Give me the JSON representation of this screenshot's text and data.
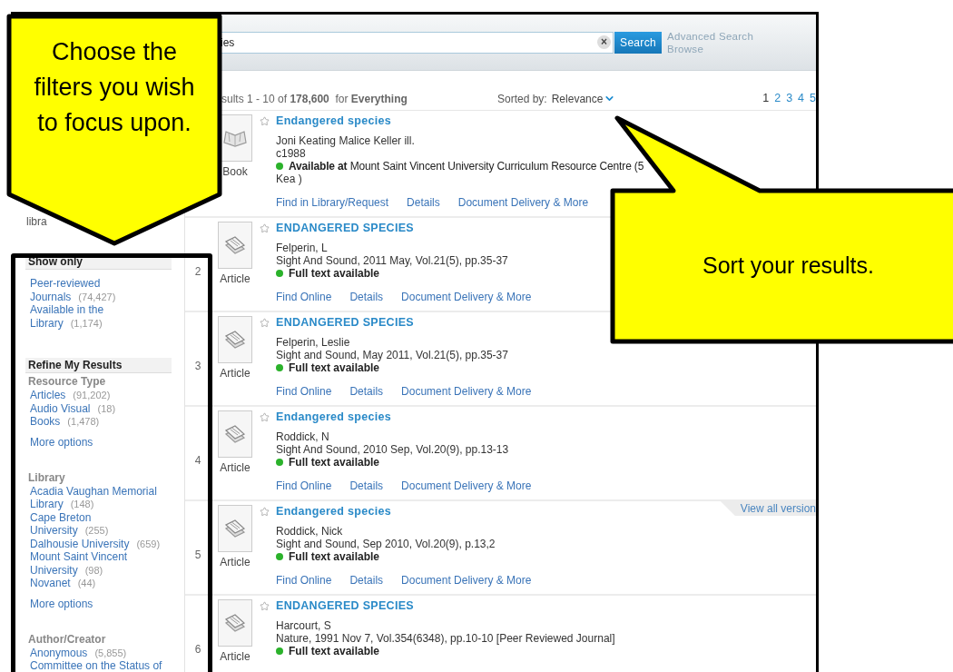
{
  "search": {
    "value": "ies",
    "clear": "×",
    "button": "Search",
    "links": [
      "Advanced Search",
      "Browse"
    ]
  },
  "results_bar": {
    "summary": "sults 1 - 10 of **178,600**  for **Everything**",
    "sort_label": "Sorted by:",
    "sort_value": "Relevance",
    "pages": [
      {
        "label": "1",
        "selected": true
      },
      {
        "label": "2",
        "selected": false
      },
      {
        "label": "3",
        "selected": false
      },
      {
        "label": "4",
        "selected": false
      },
      {
        "label": "5",
        "selected": false
      }
    ]
  },
  "sidebar": {
    "fragment": "libra",
    "show_only": {
      "heading": "Show only",
      "items": [
        {
          "label": "Peer-reviewed Journals",
          "count": "(74,427)"
        },
        {
          "label": "Available in the Library",
          "count": "(1,174)"
        }
      ]
    },
    "refine": {
      "heading": "Refine My Results",
      "facets": [
        {
          "title": "Resource Type",
          "items": [
            {
              "label": "Articles",
              "count": "(91,202)"
            },
            {
              "label": "Audio Visual",
              "count": "(18)"
            },
            {
              "label": "Books",
              "count": "(1,478)"
            }
          ],
          "more": "More options"
        },
        {
          "title": "Library",
          "items": [
            {
              "label": "Acadia Vaughan Memorial Library",
              "count": "(148)"
            },
            {
              "label": "Cape Breton University",
              "count": "(255)"
            },
            {
              "label": "Dalhousie University",
              "count": "(659)"
            },
            {
              "label": "Mount Saint Vincent University",
              "count": "(98)"
            },
            {
              "label": "Novanet",
              "count": "(44)"
            }
          ],
          "more": "More options"
        },
        {
          "title": "Author/Creator",
          "items": [
            {
              "label": "Anonymous",
              "count": "(5,855)"
            },
            {
              "label": "Committee on the Status of"
            }
          ]
        }
      ]
    }
  },
  "results": [
    {
      "format": "Book",
      "kind": "book",
      "title": "Endangered species",
      "lines": [
        "Joni Keating Malice Keller ill.",
        "c1988"
      ],
      "availability": {
        "kind": "location",
        "text": "**Available at** Mount Saint Vincent University Curriculum Resource Centre (5",
        "more": "Kea )"
      },
      "links": [
        "Find in Library/Request",
        "Details",
        "Document Delivery & More"
      ]
    },
    {
      "number": "2",
      "format": "Article",
      "kind": "article",
      "title": "ENDANGERED SPECIES",
      "lines": [
        "Felperin, L",
        "Sight And Sound, 2011 May, Vol.21(5), pp.35-37"
      ],
      "availability": {
        "kind": "full_text",
        "text": "Full text available"
      },
      "links": [
        "Find Online",
        "Details",
        "Document Delivery & More"
      ]
    },
    {
      "number": "3",
      "format": "Article",
      "kind": "article",
      "title": "ENDANGERED SPECIES",
      "lines": [
        "Felperin, Leslie",
        "Sight and Sound, May 2011, Vol.21(5), pp.35-37"
      ],
      "availability": {
        "kind": "full_text",
        "text": "Full text available"
      },
      "links": [
        "Find Online",
        "Details",
        "Document Delivery & More"
      ]
    },
    {
      "number": "4",
      "format": "Article",
      "kind": "article",
      "title": "Endangered species",
      "lines": [
        "Roddick, N",
        "Sight And Sound, 2010 Sep, Vol.20(9), pp.13-13"
      ],
      "availability": {
        "kind": "full_text",
        "text": "Full text available"
      },
      "links": [
        "Find Online",
        "Details",
        "Document Delivery & More"
      ]
    },
    {
      "number": "5",
      "format": "Article",
      "kind": "article",
      "title": "Endangered species",
      "lines": [
        "Roddick, Nick",
        "Sight and Sound, Sep 2010, Vol.20(9), p.13,2"
      ],
      "availability": {
        "kind": "full_text",
        "text": "Full text available"
      },
      "links": [
        "Find Online",
        "Details",
        "Document Delivery & More"
      ],
      "versions_tab": "View all version"
    },
    {
      "number": "6",
      "format": "Article",
      "kind": "article",
      "title": "ENDANGERED SPECIES",
      "lines": [
        "Harcourt, S",
        "Nature, 1991 Nov 7, Vol.354(6348), pp.10-10 [Peer Reviewed Journal]"
      ],
      "availability": {
        "kind": "full_text",
        "text": "Full text available"
      }
    }
  ],
  "callouts": [
    {
      "kind": "down_arrow",
      "text": "Choose the filters you wish to focus upon."
    },
    {
      "kind": "speech",
      "text": "Sort your results."
    }
  ]
}
